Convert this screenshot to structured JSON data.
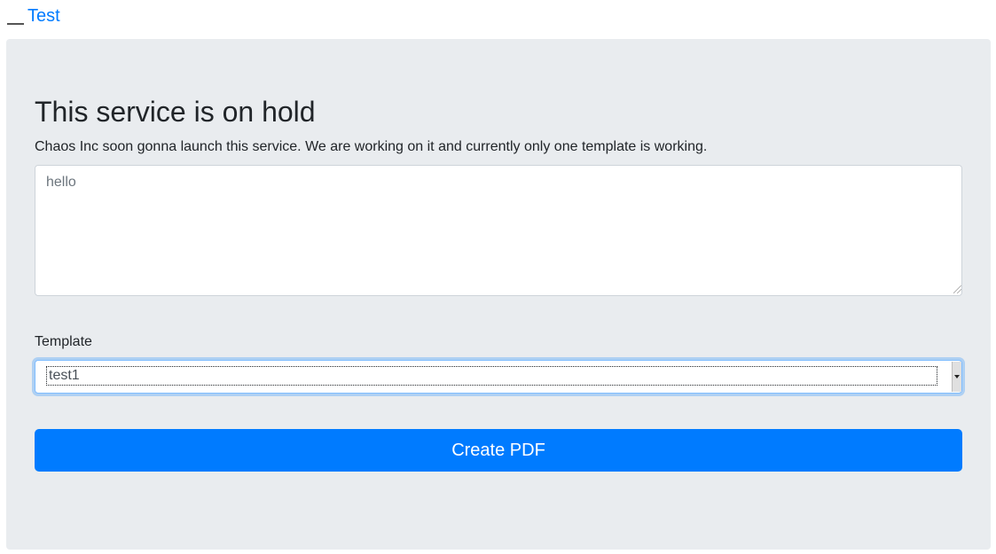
{
  "nav": {
    "brand_label": "Test",
    "brand_icon": "broken-image-icon"
  },
  "hero": {
    "title": "This service is on hold",
    "lead": "Chaos Inc soon gonna launch this service. We are working on it and currently only one template is working."
  },
  "form": {
    "content_placeholder": "hello",
    "content_value": "",
    "template_label": "Template",
    "template_selected": "test1",
    "submit_label": "Create PDF"
  },
  "colors": {
    "accent": "#007bff",
    "panel": "#e9ecef",
    "text": "#212529"
  }
}
